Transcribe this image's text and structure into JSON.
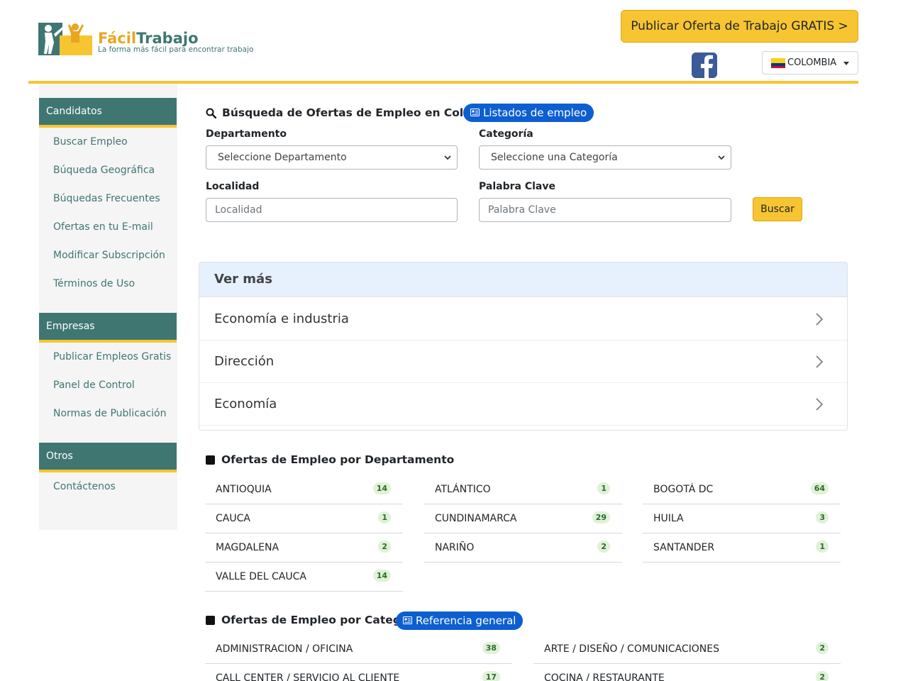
{
  "header": {
    "logo_word1": "Fácil",
    "logo_word2": "Trabajo",
    "logo_tagline": "La forma más fácil para encontrar trabajo",
    "publish_button": "Publicar Oferta de Trabajo GRATIS >",
    "facebook_icon": "facebook-icon",
    "country": "COLOMBIA"
  },
  "sidebar": {
    "sections": [
      {
        "title": "Candidatos",
        "items": [
          "Buscar Empleo",
          "Búqueda Geográfica",
          "Búquedas Frecuentes",
          "Ofertas en tu E-mail",
          "Modificar Subscripción",
          "Términos de Uso"
        ]
      },
      {
        "title": "Empresas",
        "items": [
          "Publicar Empleos Gratis",
          "Panel de Control",
          "Normas de Publicación"
        ]
      },
      {
        "title": "Otros",
        "items": [
          "Contáctenos"
        ]
      }
    ]
  },
  "search": {
    "title": "Búsqueda de Ofertas de Empleo en Colombia",
    "listings_pill": "Listados de empleo",
    "departamento_label": "Departamento",
    "departamento_value": "Seleccione Departamento",
    "categoria_label": "Categoría",
    "categoria_value": "Seleccione una Categoría",
    "localidad_label": "Localidad",
    "localidad_placeholder": "Localidad",
    "palabra_label": "Palabra Clave",
    "palabra_placeholder": "Palabra Clave",
    "buscar_button": "Buscar"
  },
  "ver_mas": {
    "title": "Ver más",
    "items": [
      "Economía e industria",
      "Dirección",
      "Economía"
    ]
  },
  "departamentos": {
    "title": "Ofertas de Empleo por Departamento",
    "items": [
      {
        "name": "ANTIOQUIA",
        "count": "14"
      },
      {
        "name": "ATLÁNTICO",
        "count": "1"
      },
      {
        "name": "BOGOTÁ DC",
        "count": "64"
      },
      {
        "name": "CAUCA",
        "count": "1"
      },
      {
        "name": "CUNDINAMARCA",
        "count": "29"
      },
      {
        "name": "HUILA",
        "count": "3"
      },
      {
        "name": "MAGDALENA",
        "count": "2"
      },
      {
        "name": "NARIÑO",
        "count": "2"
      },
      {
        "name": "SANTANDER",
        "count": "1"
      },
      {
        "name": "VALLE DEL CAUCA",
        "count": "14"
      }
    ]
  },
  "categorias": {
    "title": "Ofertas de Empleo por Categoría",
    "pill": "Referencia general",
    "items": [
      {
        "name": "ADMINISTRACION / OFICINA",
        "count": "38"
      },
      {
        "name": "ARTE / DISEÑO / COMUNICACIONES",
        "count": "2"
      },
      {
        "name": "CALL CENTER / SERVICIO AL CLIENTE",
        "count": "17"
      },
      {
        "name": "COCINA / RESTAURANTE",
        "count": "2"
      }
    ]
  },
  "colors": {
    "brand_green": "#3f7672",
    "brand_yellow": "#f7c531",
    "pill_blue": "#0d5fd1",
    "badge_bg": "#dff2d8"
  }
}
